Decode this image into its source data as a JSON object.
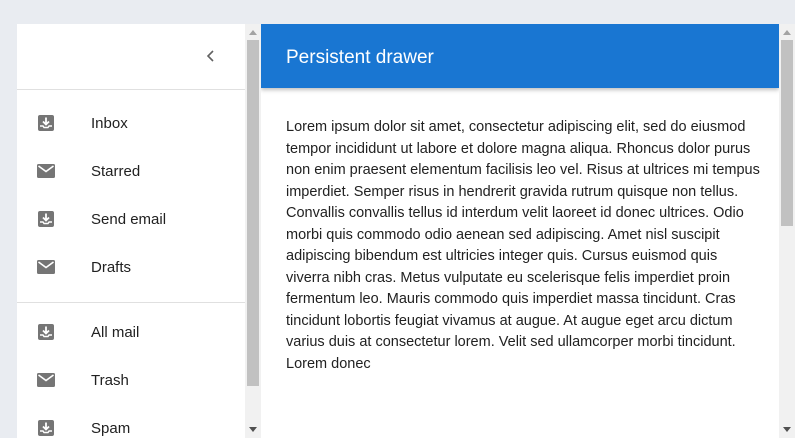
{
  "drawer": {
    "close_icon": "chevron-left-icon",
    "groups": [
      [
        {
          "label": "Inbox",
          "icon": "move-to-inbox-icon"
        },
        {
          "label": "Starred",
          "icon": "mail-icon"
        },
        {
          "label": "Send email",
          "icon": "move-to-inbox-icon"
        },
        {
          "label": "Drafts",
          "icon": "mail-icon"
        }
      ],
      [
        {
          "label": "All mail",
          "icon": "move-to-inbox-icon"
        },
        {
          "label": "Trash",
          "icon": "mail-icon"
        },
        {
          "label": "Spam",
          "icon": "move-to-inbox-icon"
        }
      ]
    ]
  },
  "appbar": {
    "title": "Persistent drawer",
    "color": "#1976d2"
  },
  "main": {
    "paragraph": "Lorem ipsum dolor sit amet, consectetur adipiscing elit, sed do eiusmod tempor incididunt ut labore et dolore magna aliqua. Rhoncus dolor purus non enim praesent elementum facilisis leo vel. Risus at ultrices mi tempus imperdiet. Semper risus in hendrerit gravida rutrum quisque non tellus. Convallis convallis tellus id interdum velit laoreet id donec ultrices. Odio morbi quis commodo odio aenean sed adipiscing. Amet nisl suscipit adipiscing bibendum est ultricies integer quis. Cursus euismod quis viverra nibh cras. Metus vulputate eu scelerisque felis imperdiet proin fermentum leo. Mauris commodo quis imperdiet massa tincidunt. Cras tincidunt lobortis feugiat vivamus at augue. At augue eget arcu dictum varius duis at consectetur lorem. Velit sed ullamcorper morbi tincidunt. Lorem donec"
  }
}
